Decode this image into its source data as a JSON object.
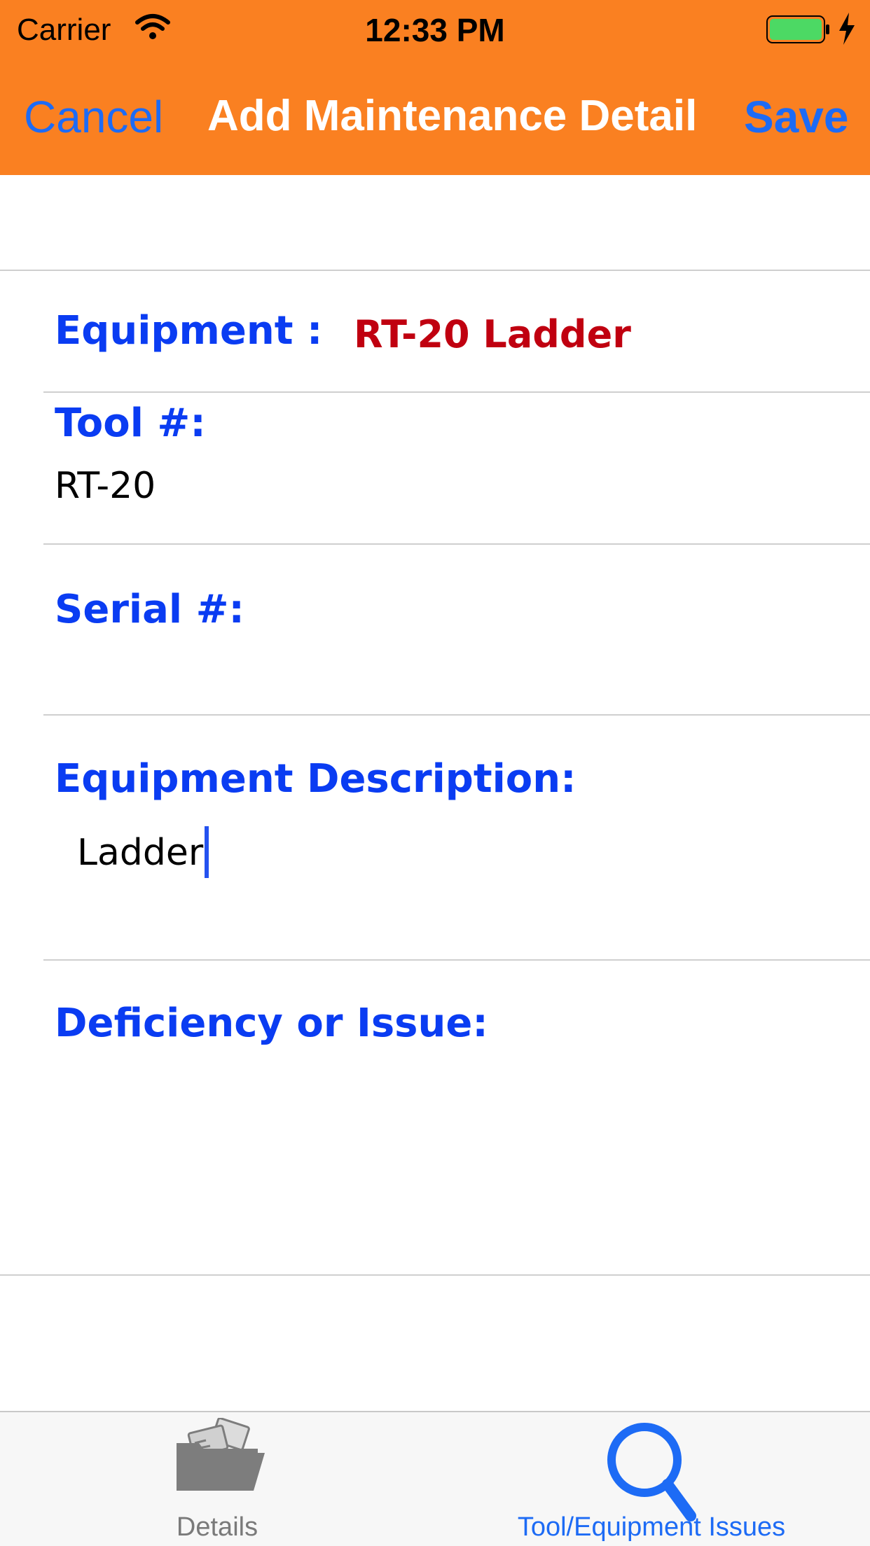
{
  "status_bar": {
    "carrier": "Carrier",
    "time": "12:33 PM",
    "wifi_icon": "wifi-icon",
    "battery_icon": "battery-charging-icon",
    "battery_color": "#4CD964"
  },
  "nav": {
    "cancel": "Cancel",
    "title": "Add Maintenance Detail",
    "save": "Save",
    "bar_color": "#FA8021",
    "button_color": "#1D6BF5"
  },
  "form": {
    "equipment_label": "Equipment :",
    "equipment_value": "RT-20 Ladder",
    "tool_label": "Tool #:",
    "tool_value": "RT-20",
    "serial_label": "Serial #:",
    "serial_value": "",
    "description_label": "Equipment Description:",
    "description_value": "Ladder",
    "deficiency_label": "Deficiency or Issue:",
    "deficiency_value": "",
    "label_color": "#0A3CF2",
    "equipment_value_color": "#C00010"
  },
  "tabs": [
    {
      "label": "Details",
      "icon": "folder-icon",
      "selected": false
    },
    {
      "label": "Tool/Equipment Issues",
      "icon": "search-icon",
      "selected": true
    }
  ]
}
